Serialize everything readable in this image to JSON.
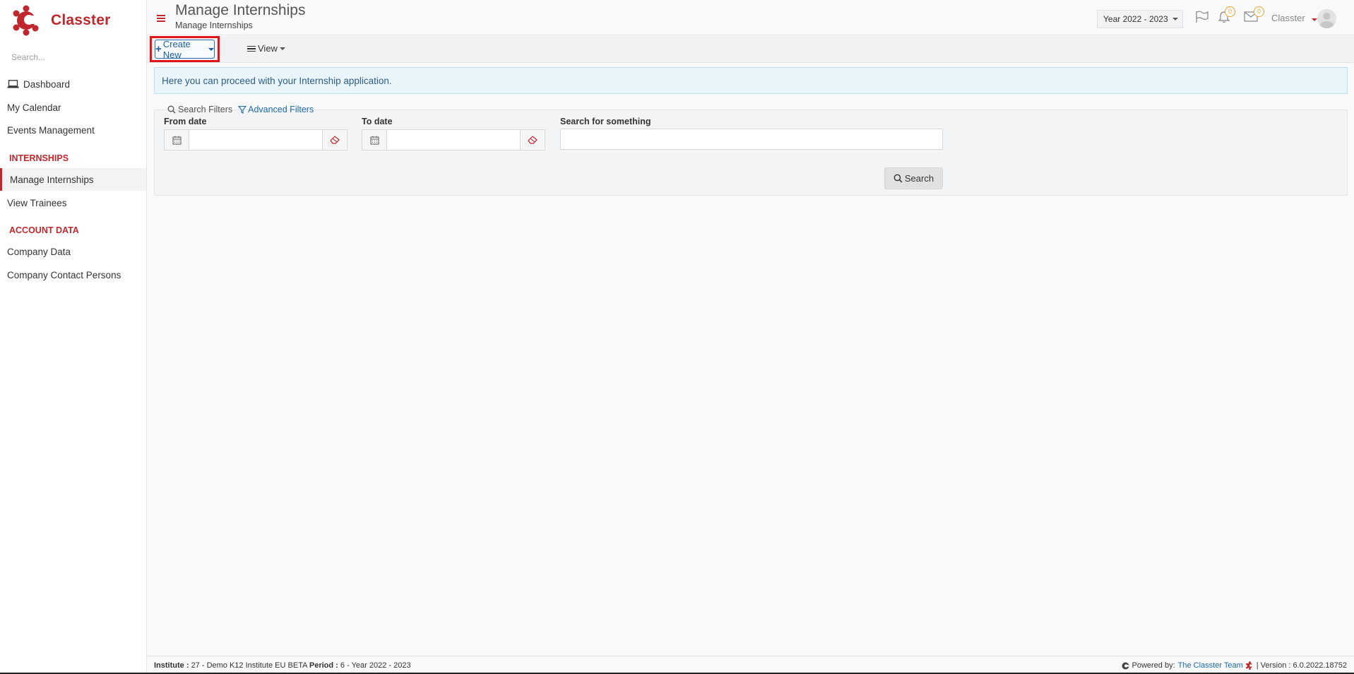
{
  "brand": {
    "name": "Classter",
    "color": "#c0272d"
  },
  "sidebar": {
    "search_placeholder": "Search...",
    "items": [
      {
        "label": "Dashboard",
        "icon": "laptop-icon"
      },
      {
        "label": "My Calendar"
      },
      {
        "label": "Events Management"
      }
    ],
    "section_internships": "INTERNSHIPS",
    "internship_items": [
      {
        "label": "Manage Internships",
        "active": true
      },
      {
        "label": "View Trainees"
      }
    ],
    "section_account": "ACCOUNT DATA",
    "account_items": [
      {
        "label": "Company Data"
      },
      {
        "label": "Company Contact Persons"
      }
    ]
  },
  "header": {
    "title": "Manage Internships",
    "subtitle": "Manage Internships",
    "year": "Year 2022 - 2023",
    "notifications_count": "0",
    "messages_count": "0",
    "user": "Classter"
  },
  "toolbar": {
    "create_label": "Create New",
    "view_label": "View"
  },
  "info_text": "Here you can proceed with your Internship application.",
  "filters": {
    "search_filters_label": "Search Filters",
    "advanced_filters_label": "Advanced Filters",
    "from_date_label": "From date",
    "from_date_value": "",
    "to_date_label": "To date",
    "to_date_value": "",
    "search_label": "Search for something",
    "search_value": "",
    "search_button": "Search"
  },
  "footer": {
    "institute_label": "Institute :",
    "institute_value": "27 - Demo K12 Institute EU BETA",
    "period_label": "Period :",
    "period_value": "6 - Year 2022 - 2023",
    "powered_by": "Powered by:",
    "team": "The Classter Team",
    "version": "| Version : 6.0.2022.18752"
  }
}
